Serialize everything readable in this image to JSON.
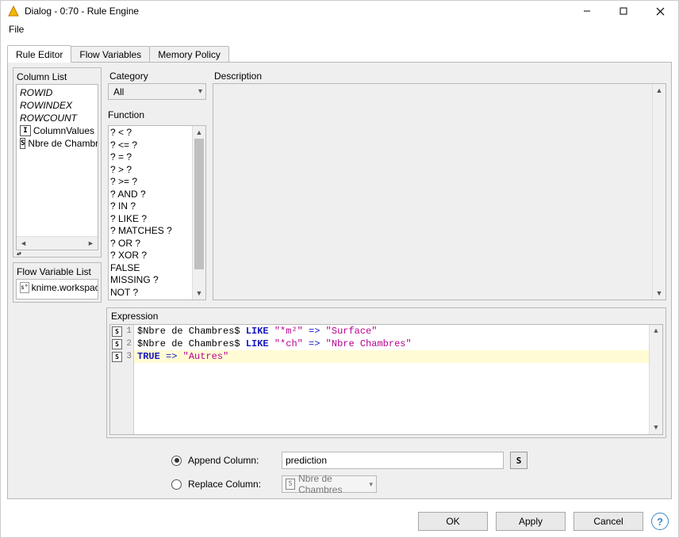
{
  "window": {
    "title": "Dialog - 0:70 - Rule Engine"
  },
  "menubar": {
    "file": "File"
  },
  "tabs": {
    "rule_editor": "Rule Editor",
    "flow_variables": "Flow Variables",
    "memory_policy": "Memory Policy"
  },
  "column_list": {
    "title": "Column List",
    "items": [
      {
        "label": "ROWID",
        "italic": true,
        "icon": null
      },
      {
        "label": "ROWINDEX",
        "italic": true,
        "icon": null
      },
      {
        "label": "ROWCOUNT",
        "italic": true,
        "icon": null
      },
      {
        "label": "ColumnValues",
        "italic": false,
        "icon": "I"
      },
      {
        "label": "Nbre de Chambres",
        "italic": false,
        "icon": "S"
      }
    ]
  },
  "flow_variables_panel": {
    "title": "Flow Variable List",
    "items": [
      {
        "label": "knime.workspace",
        "icon": "s°"
      }
    ]
  },
  "category": {
    "label": "Category",
    "selected": "All"
  },
  "function_panel": {
    "title": "Function",
    "items": [
      "? < ?",
      "? <= ?",
      "? = ?",
      "? > ?",
      "? >= ?",
      "? AND ?",
      "? IN ?",
      "? LIKE ?",
      "? MATCHES ?",
      "? OR ?",
      "? XOR ?",
      "FALSE",
      "MISSING ?",
      "NOT ?"
    ]
  },
  "description": {
    "label": "Description"
  },
  "expression": {
    "title": "Expression",
    "lines": [
      {
        "n": 1,
        "icon": "S",
        "hl": false,
        "segments": [
          {
            "t": "$Nbre de Chambres$ ",
            "c": "plain"
          },
          {
            "t": "LIKE",
            "c": "kw"
          },
          {
            "t": " ",
            "c": "plain"
          },
          {
            "t": "\"*m²\"",
            "c": "str"
          },
          {
            "t": " => ",
            "c": "sym"
          },
          {
            "t": "\"Surface\"",
            "c": "str"
          }
        ]
      },
      {
        "n": 2,
        "icon": "S",
        "hl": false,
        "segments": [
          {
            "t": "$Nbre de Chambres$ ",
            "c": "plain"
          },
          {
            "t": "LIKE",
            "c": "kw"
          },
          {
            "t": " ",
            "c": "plain"
          },
          {
            "t": "\"*ch\"",
            "c": "str"
          },
          {
            "t": " => ",
            "c": "sym"
          },
          {
            "t": "\"Nbre Chambres\"",
            "c": "str"
          }
        ]
      },
      {
        "n": 3,
        "icon": "S",
        "hl": true,
        "segments": [
          {
            "t": "TRUE",
            "c": "kw"
          },
          {
            "t": " => ",
            "c": "sym"
          },
          {
            "t": "\"Autres\"",
            "c": "str"
          }
        ]
      }
    ]
  },
  "output": {
    "append_label": "Append Column:",
    "append_value": "prediction",
    "append_type": "S",
    "replace_label": "Replace Column:",
    "replace_value": "Nbre de Chambres",
    "replace_type": "S"
  },
  "buttons": {
    "ok": "OK",
    "apply": "Apply",
    "cancel": "Cancel"
  }
}
